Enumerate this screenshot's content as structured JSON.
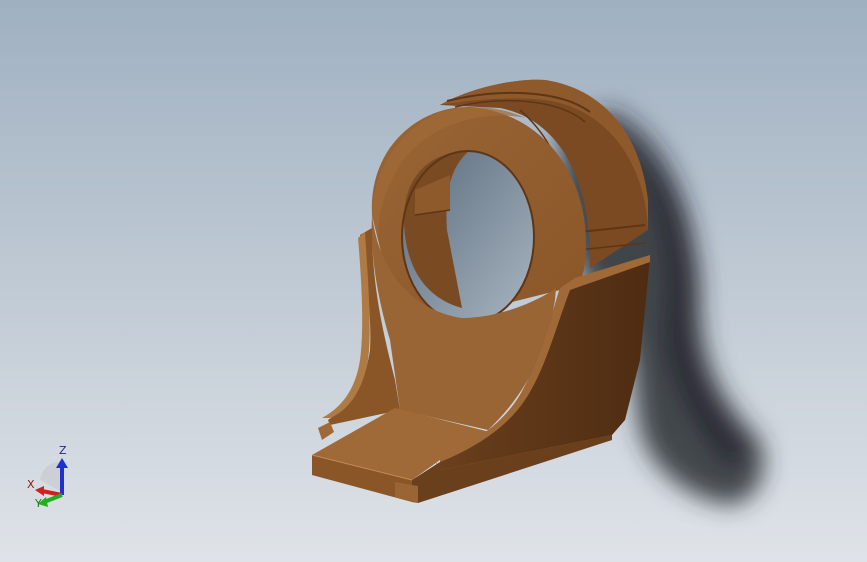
{
  "viewport": {
    "background_top": "#9fb0c1",
    "background_bottom": "#dfe3e8"
  },
  "model": {
    "color": "#8b5a2b"
  },
  "triad": {
    "z_label": "Z",
    "x_label": "X",
    "y_label": "Y",
    "z_color": "#1f2fd0",
    "x_color": "#d01f1f",
    "y_color": "#1fb01f"
  }
}
